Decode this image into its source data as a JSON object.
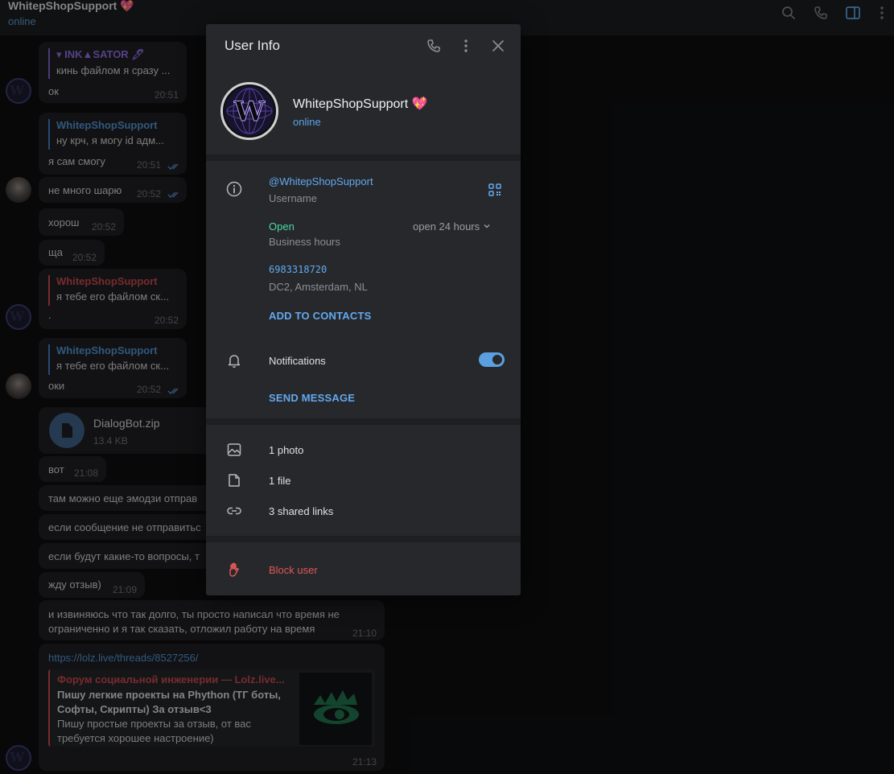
{
  "header": {
    "title": "WhitepShopSupport 💖",
    "status": "online",
    "icons": [
      "search-icon",
      "phone-icon",
      "sidebar-icon",
      "more-icon"
    ]
  },
  "messages": {
    "m1": {
      "reply_name": "▾ INK▲SATOR 🖊",
      "reply_text": "кинь файлом я сразу ...",
      "text": "ок",
      "time": "20:51"
    },
    "m2": {
      "reply_name": "WhitepShopSupport",
      "reply_text": "ну крч, я могу id адм...",
      "text": "я сам смогу",
      "time": "20:51"
    },
    "m3": {
      "text": "не много шарю",
      "time": "20:52"
    },
    "m4": {
      "text": "хорош",
      "time": "20:52"
    },
    "m5": {
      "text": "ща",
      "time": "20:52"
    },
    "m6": {
      "reply_name": "WhitepShopSupport",
      "reply_text": "я тебе его файлом ск...",
      "text": ".",
      "time": "20:52"
    },
    "m7": {
      "reply_name": "WhitepShopSupport",
      "reply_text": "я тебе его файлом ск...",
      "text": "оки",
      "time": "20:52"
    },
    "m8": {
      "file_name": "DialogBot.zip",
      "file_size": "13.4 KB"
    },
    "m9": {
      "text": "вот",
      "time": "21:08"
    },
    "m10": {
      "text": "там можно еще эмодзи отправ"
    },
    "m11": {
      "text": "если сообщение не отправитьс"
    },
    "m12": {
      "text": "если будут какие-то вопросы, т"
    },
    "m13": {
      "text": "жду отзыв)",
      "time": "21:09"
    },
    "m14": {
      "line1": "и извиняюсь что так долго, ты просто написал что время не",
      "line2": "ограниченно и я так сказать, отложил работу на время",
      "time": "21:10"
    },
    "m15": {
      "link": "https://lolz.live/threads/8527256/",
      "preview_site": "Форум социальной инженерии — Lolz.live...",
      "preview_title1": "Пишу легкие проекты на Phython (ТГ боты,",
      "preview_title2": "Софты, Скрипты) За отзыв<3",
      "preview_desc1": "Пишу простые проекты за отзыв, от вас",
      "preview_desc2": "требуется хорошее настроение)",
      "time": "21:13"
    }
  },
  "panel": {
    "title": "User Info",
    "name": "WhitepShopSupport 💖",
    "status": "online",
    "username_value": "@WhitepShopSupport",
    "username_label": "Username",
    "business_value": "Open",
    "business_label": "Business hours",
    "business_dropdown": "open 24 hours",
    "id_value": "6983318720",
    "id_label": "DC2, Amsterdam, NL",
    "add_contacts": "ADD TO CONTACTS",
    "notifications_label": "Notifications",
    "notifications_on": true,
    "send_message": "SEND MESSAGE",
    "media": {
      "photos": "1 photo",
      "files": "1 file",
      "links": "3 shared links"
    },
    "block": "Block user"
  },
  "colors": {
    "accent": "#63a9ee",
    "open_green": "#4fd8a4",
    "danger": "#e25858",
    "reply_blue": "#3f7ac0",
    "reply_red": "#c0464b",
    "reply_purple": "#7b5cc6"
  }
}
